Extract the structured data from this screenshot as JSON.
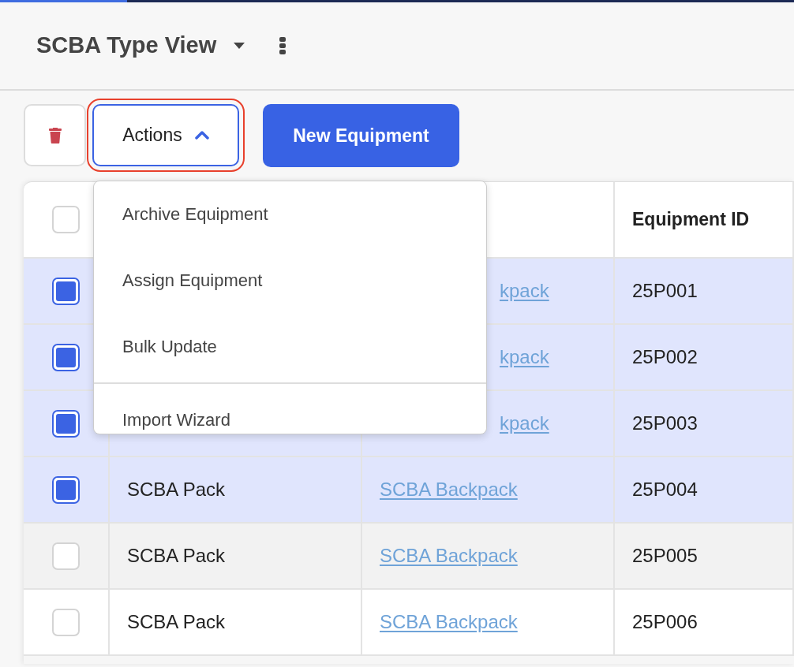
{
  "progress": {
    "level": 0.16
  },
  "header": {
    "title": "SCBA Type View"
  },
  "toolbar": {
    "actions": {
      "label": "Actions",
      "expanded": true,
      "highlighted": true
    },
    "new_button": "New Equipment"
  },
  "actions_menu": [
    {
      "label": "Archive Equipment",
      "divider_before": false
    },
    {
      "label": "Assign Equipment",
      "divider_before": false
    },
    {
      "label": "Bulk Update",
      "divider_before": false
    },
    {
      "label": "Import Wizard",
      "divider_before": true
    }
  ],
  "table": {
    "select_all": false,
    "columns": [
      {
        "label": "Equipment ID"
      }
    ],
    "rows": [
      {
        "selected": true,
        "model": "kpack",
        "model_cut": true,
        "id": "25P001"
      },
      {
        "selected": true,
        "model": "kpack",
        "model_cut": true,
        "id": "25P002"
      },
      {
        "selected": true,
        "model": "kpack",
        "model_cut": true,
        "id": "25P003"
      },
      {
        "selected": true,
        "type": "SCBA Pack",
        "model": "SCBA Backpack",
        "model_cut": false,
        "id": "25P004"
      },
      {
        "selected": false,
        "hovered": true,
        "type": "SCBA Pack",
        "model": "SCBA Backpack",
        "model_cut": false,
        "id": "25P005"
      },
      {
        "selected": false,
        "type": "SCBA Pack",
        "model": "SCBA Backpack",
        "model_cut": false,
        "id": "25P006"
      }
    ]
  }
}
